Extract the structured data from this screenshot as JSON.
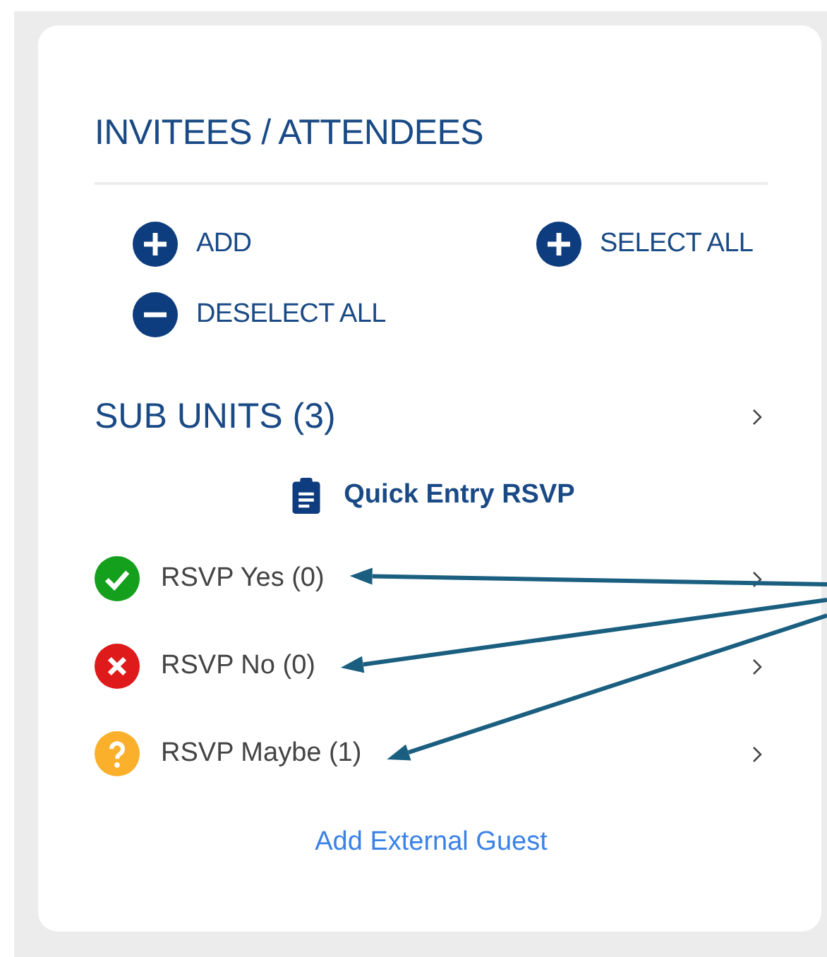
{
  "panel": {
    "title": "INVITEES / ATTENDEES",
    "actions": [
      {
        "label": "ADD",
        "kind": "plus"
      },
      {
        "label": "SELECT ALL",
        "kind": "plus"
      },
      {
        "label": "DESELECT ALL",
        "kind": "minus"
      }
    ],
    "sub_units": {
      "label": "SUB UNITS (3)"
    },
    "quick_entry": {
      "label": "Quick Entry RSVP"
    },
    "rsvp_rows": [
      {
        "label": "RSVP Yes (0)",
        "kind": "yes",
        "pointed": true
      },
      {
        "label": "RSVP No (0)",
        "kind": "no",
        "pointed": true
      },
      {
        "label": "RSVP Maybe (1)",
        "kind": "maybe",
        "pointed": true
      }
    ],
    "link": "Add External Guest"
  }
}
